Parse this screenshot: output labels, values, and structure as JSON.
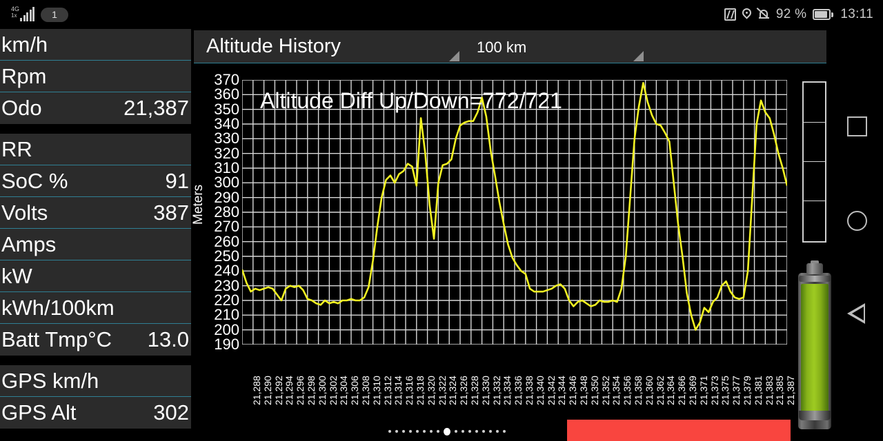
{
  "statusbar": {
    "network_type": "4G",
    "network_sub": "1x",
    "sim_badge": "1",
    "icons": [
      "nfc-icon",
      "location-icon",
      "bell-muted-icon",
      "battery-icon"
    ],
    "battery_percent": "92 %",
    "clock": "13:11"
  },
  "panel": {
    "rows": [
      {
        "label": "km/h",
        "value": ""
      },
      {
        "label": "Rpm",
        "value": ""
      },
      {
        "label": "Odo",
        "value": "21,387"
      },
      {
        "label": "RR",
        "value": ""
      },
      {
        "label": "SoC %",
        "value": "91"
      },
      {
        "label": "Volts",
        "value": "387"
      },
      {
        "label": "Amps",
        "value": ""
      },
      {
        "label": "kW",
        "value": ""
      },
      {
        "label": "kWh/100km",
        "value": ""
      },
      {
        "label": "Batt Tmp°C",
        "value": "13.0"
      },
      {
        "label": "GPS km/h",
        "value": ""
      },
      {
        "label": "GPS Alt",
        "value": "302"
      }
    ]
  },
  "toolbar": {
    "view_selector": "Altitude History",
    "range_selector": "100 km"
  },
  "colors": {
    "accent_line": "#2f7f94",
    "series": "#f2f222",
    "grid": "#d8d8d8",
    "panel_bg": "#2b2b2b",
    "red_bar": "#f9453f",
    "battery_fill": "#9ecb22"
  },
  "bottom": {
    "page_dots_total": 17,
    "page_dots_active_index": 8
  },
  "nav": {
    "recents_label": "square-recents",
    "home_label": "circle-home",
    "back_label": "triangle-back"
  },
  "chart_data": {
    "type": "line",
    "title": "Altitude Diff Up/Down=772/721",
    "xlabel": "",
    "ylabel": "Meters",
    "ylim": [
      190,
      370
    ],
    "ytick_step": 10,
    "yticks": [
      370,
      360,
      350,
      340,
      330,
      320,
      310,
      300,
      290,
      280,
      270,
      260,
      250,
      240,
      230,
      220,
      210,
      200,
      190
    ],
    "grid": true,
    "legend": null,
    "series_color": "#f2f222",
    "xticks": [
      "21,288",
      "21,290",
      "21,292",
      "21,294",
      "21,296",
      "21,298",
      "21,300",
      "21,302",
      "21,304",
      "21,306",
      "21,308",
      "21,310",
      "21,312",
      "21,314",
      "21,316",
      "21,318",
      "21,320",
      "21,322",
      "21,324",
      "21,326",
      "21,328",
      "21,330",
      "21,332",
      "21,334",
      "21,336",
      "21,338",
      "21,340",
      "21,342",
      "21,344",
      "21,346",
      "21,348",
      "21,350",
      "21,352",
      "21,354",
      "21,356",
      "21,358",
      "21,360",
      "21,362",
      "21,364",
      "21,366",
      "21,369",
      "21,371",
      "21,373",
      "21,375",
      "21,377",
      "21,379",
      "21,381",
      "21,383",
      "21,385",
      "21,387"
    ],
    "x": [
      0,
      1,
      2,
      3,
      4,
      5,
      6,
      7,
      8,
      9,
      10,
      11,
      12,
      13,
      14,
      15,
      16,
      17,
      18,
      19,
      20,
      21,
      22,
      23,
      24,
      25,
      26,
      27,
      28,
      29,
      30,
      31,
      32,
      33,
      34,
      35,
      36,
      37,
      38,
      39,
      40,
      41,
      42,
      43,
      44,
      45,
      46,
      47,
      48,
      49,
      50,
      51,
      52,
      53,
      54,
      55,
      56,
      57,
      58,
      59,
      60,
      61,
      62,
      63,
      64,
      65,
      66,
      67,
      68,
      69,
      70,
      71,
      72,
      73,
      74,
      75,
      76,
      77,
      78,
      79,
      80,
      81,
      82,
      83,
      84,
      85,
      86,
      87,
      88,
      89,
      90,
      91,
      92,
      93,
      94,
      95,
      96,
      97,
      98,
      99,
      100,
      101,
      102,
      103,
      104,
      105,
      106,
      107,
      108,
      109,
      110,
      111,
      112,
      113,
      114,
      115,
      116,
      117,
      118,
      119
    ],
    "values": [
      241,
      232,
      226,
      228,
      227,
      228,
      229,
      228,
      224,
      220,
      228,
      230,
      229,
      230,
      227,
      221,
      220,
      218,
      217,
      220,
      218,
      219,
      218,
      220,
      220,
      221,
      220,
      220,
      222,
      229,
      247,
      270,
      290,
      302,
      305,
      300,
      306,
      308,
      313,
      311,
      298,
      344,
      320,
      285,
      262,
      300,
      312,
      313,
      316,
      330,
      339,
      341,
      342,
      342,
      348,
      358,
      345,
      322,
      305,
      287,
      272,
      258,
      249,
      244,
      240,
      238,
      228,
      226,
      226,
      226,
      227,
      228,
      230,
      231,
      228,
      220,
      216,
      219,
      220,
      218,
      216,
      217,
      220,
      219,
      219,
      220,
      219,
      228,
      250,
      290,
      330,
      352,
      368,
      355,
      346,
      340,
      339,
      334,
      328,
      300,
      272,
      250,
      225,
      210,
      200,
      205,
      215,
      212,
      219,
      222,
      230,
      233,
      226,
      222,
      221,
      222,
      240,
      290,
      340,
      356,
      348,
      344,
      333,
      320,
      310,
      298
    ]
  }
}
